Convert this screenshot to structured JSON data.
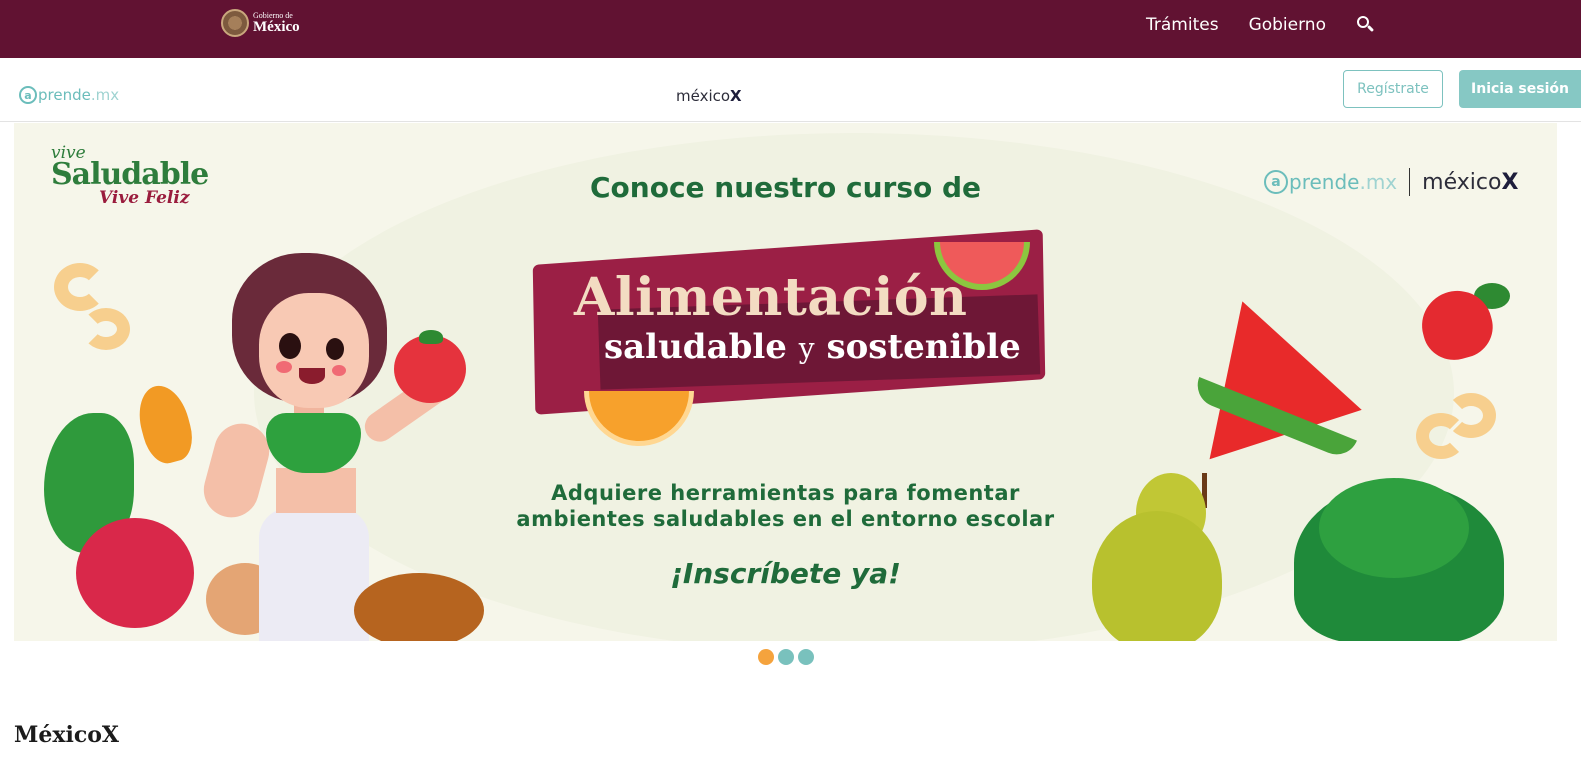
{
  "gov_bar": {
    "logo_small": "Gobierno de",
    "logo_big": "México",
    "nav": [
      "Trámites",
      "Gobierno"
    ],
    "search_icon": "search-icon",
    "background_color": "#611232"
  },
  "header": {
    "aprende_logo": {
      "at": "a",
      "name": "prende",
      "tld": ".mx"
    },
    "mexicox_logo": {
      "text": "méxico",
      "x": "X"
    },
    "register_label": "Regístrate",
    "login_label": "Inicia sesión",
    "accent_color": "#86c8c4"
  },
  "banner": {
    "brand_top_left": {
      "vive": "vive",
      "saludable": "Saludable",
      "feliz": "Vive Feliz"
    },
    "brand_top_right": {
      "aprende": "prende",
      "aprende_at": "a",
      "aprende_tld": ".mx",
      "mexico": "méxico",
      "x": "X"
    },
    "intro": "Conoce nuestro curso de",
    "title": "Alimentación",
    "subtitle_a": "saludable",
    "subtitle_y": "y",
    "subtitle_b": "sostenible",
    "description_line1": "Adquiere herramientas para fomentar",
    "description_line2": "ambientes saludables en el entorno escolar",
    "cta": "¡Inscríbete ya!"
  },
  "carousel": {
    "slides": 3,
    "active_index": 0,
    "active_color": "#f5a33d",
    "inactive_color": "#79c1bd"
  },
  "main": {
    "section_title": "MéxicoX"
  }
}
